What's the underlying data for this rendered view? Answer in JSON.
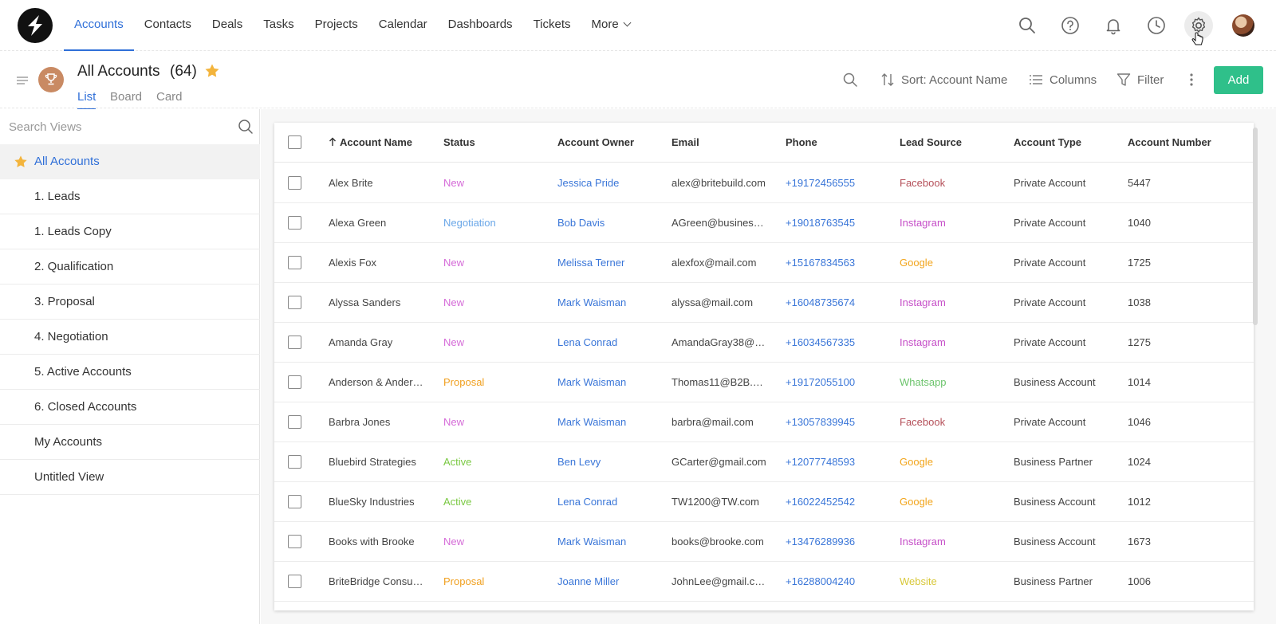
{
  "nav": {
    "tabs": [
      {
        "label": "Accounts",
        "active": true
      },
      {
        "label": "Contacts"
      },
      {
        "label": "Deals"
      },
      {
        "label": "Tasks"
      },
      {
        "label": "Projects"
      },
      {
        "label": "Calendar"
      },
      {
        "label": "Dashboards"
      },
      {
        "label": "Tickets"
      },
      {
        "label": "More"
      }
    ],
    "icons": [
      "search-icon",
      "help-icon",
      "bell-icon",
      "clock-icon",
      "gear-icon",
      "avatar"
    ]
  },
  "header": {
    "title": "All Accounts",
    "count": "(64)",
    "view_tabs": [
      "List",
      "Board",
      "Card"
    ],
    "sort_label": "Sort: Account Name",
    "columns_label": "Columns",
    "filter_label": "Filter",
    "add_label": "Add"
  },
  "sidebar": {
    "search_placeholder": "Search Views",
    "items": [
      "All Accounts",
      "1. Leads",
      "1. Leads Copy",
      "2. Qualification",
      "3. Proposal",
      "4. Negotiation",
      "5. Active Accounts",
      "6. Closed Accounts",
      "My Accounts",
      "Untitled View"
    ]
  },
  "table": {
    "columns": [
      "Account Name",
      "Status",
      "Account Owner",
      "Email",
      "Phone",
      "Lead Source",
      "Account Type",
      "Account Number"
    ],
    "rows": [
      [
        "Alex Brite",
        "New",
        "Jessica Pride",
        "alex@britebuild.com",
        "+19172456555",
        "Facebook",
        "Private Account",
        "5447"
      ],
      [
        "Alexa Green",
        "Negotiation",
        "Bob Davis",
        "AGreen@busines…",
        "+19018763545",
        "Instagram",
        "Private Account",
        "1040"
      ],
      [
        "Alexis Fox",
        "New",
        "Melissa Terner",
        "alexfox@mail.com",
        "+15167834563",
        "Google",
        "Private Account",
        "1725"
      ],
      [
        "Alyssa Sanders",
        "New",
        "Mark Waisman",
        "alyssa@mail.com",
        "+16048735674",
        "Instagram",
        "Private Account",
        "1038"
      ],
      [
        "Amanda Gray",
        "New",
        "Lena Conrad",
        "AmandaGray38@…",
        "+16034567335",
        "Instagram",
        "Private Account",
        "1275"
      ],
      [
        "Anderson & Ander…",
        "Proposal",
        "Mark Waisman",
        "Thomas11@B2B.…",
        "+19172055100",
        "Whatsapp",
        "Business Account",
        "1014"
      ],
      [
        "Barbra Jones",
        "New",
        "Mark Waisman",
        "barbra@mail.com",
        "+13057839945",
        "Facebook",
        "Private Account",
        "1046"
      ],
      [
        "Bluebird Strategies",
        "Active",
        "Ben Levy",
        "GCarter@gmail.com",
        "+12077748593",
        "Google",
        "Business Partner",
        "1024"
      ],
      [
        "BlueSky Industries",
        "Active",
        "Lena Conrad",
        "TW1200@TW.com",
        "+16022452542",
        "Google",
        "Business Account",
        "1012"
      ],
      [
        "Books with Brooke",
        "New",
        "Mark Waisman",
        "books@brooke.com",
        "+13476289936",
        "Instagram",
        "Business Account",
        "1673"
      ],
      [
        "BriteBridge Consu…",
        "Proposal",
        "Joanne Miller",
        "JohnLee@gmail.c…",
        "+16288004240",
        "Website",
        "Business Partner",
        "1006"
      ]
    ]
  },
  "colors": {
    "accent": "#2f6fd8",
    "add_button": "#2fc08a",
    "status": {
      "New": "#d56bd8",
      "Negotiation": "#6aa7e8",
      "Proposal": "#f0a020",
      "Active": "#7ac943"
    },
    "source": {
      "Facebook": "#b5505a",
      "Instagram": "#c64fc8",
      "Google": "#f2a51c",
      "Whatsapp": "#6cc46c",
      "Website": "#d8c83a"
    }
  }
}
